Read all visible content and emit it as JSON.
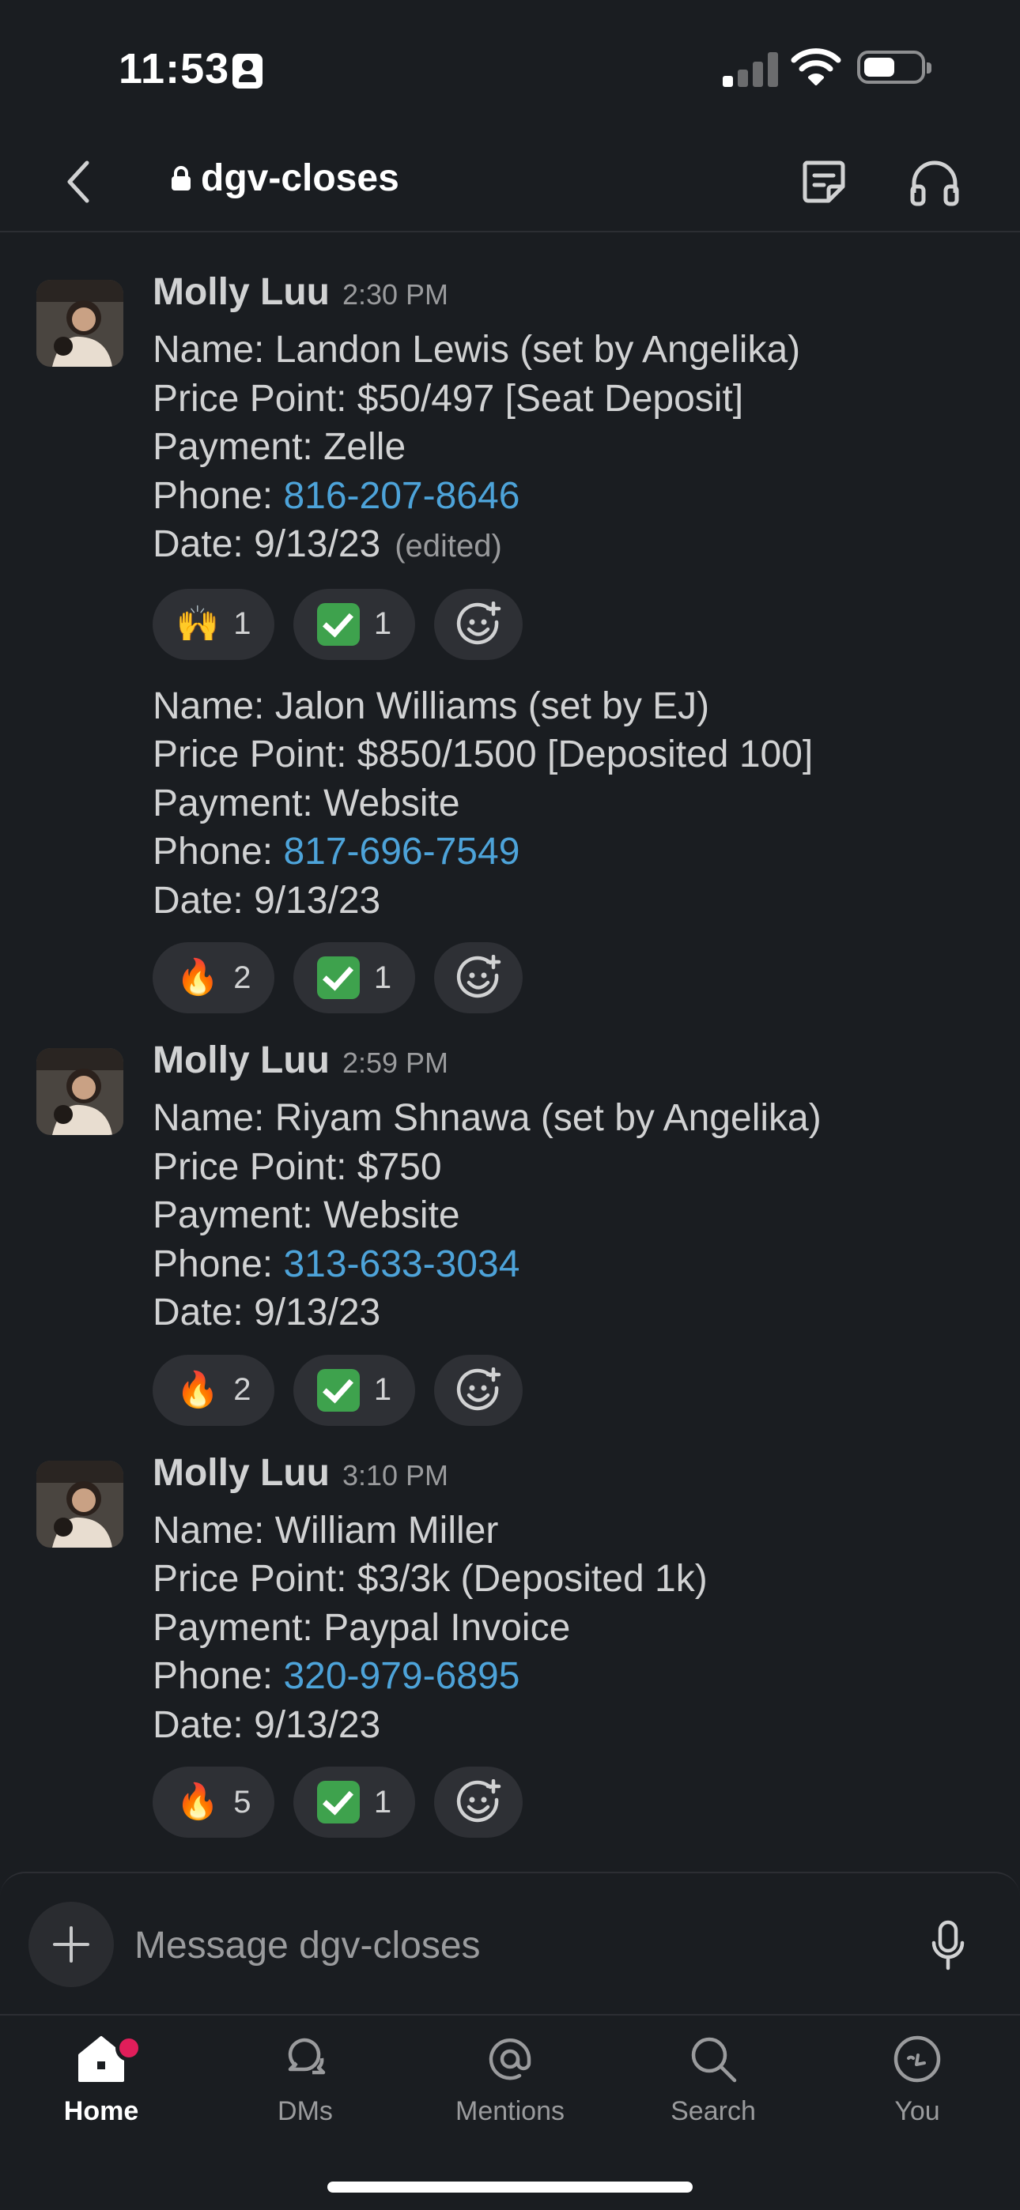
{
  "status_bar": {
    "time": "11:53"
  },
  "header": {
    "channel_name": "dgv-closes"
  },
  "messages": [
    {
      "author": "Molly Luu",
      "timestamp": "2:30 PM",
      "lines": [
        "Name: Landon Lewis (set by Angelika)",
        "Price Point: $50/497 [Seat Deposit]",
        "Payment: Zelle"
      ],
      "phone_label": "Phone: ",
      "phone": "816-207-8646",
      "date": "Date: 9/13/23",
      "edited": "(edited)",
      "reactions": [
        {
          "emoji": "🙌",
          "count": "1"
        },
        {
          "emoji": "✅",
          "count": "1"
        }
      ]
    },
    {
      "author": "",
      "timestamp": "",
      "lines": [
        "Name: Jalon Williams (set by EJ)",
        "Price Point: $850/1500 [Deposited 100]",
        "Payment: Website"
      ],
      "phone_label": "Phone: ",
      "phone": "817-696-7549",
      "date": "Date: 9/13/23",
      "reactions": [
        {
          "emoji": "🔥",
          "count": "2"
        },
        {
          "emoji": "✅",
          "count": "1"
        }
      ]
    },
    {
      "author": "Molly Luu",
      "timestamp": "2:59 PM",
      "lines": [
        "Name: Riyam Shnawa (set by Angelika)",
        "Price Point: $750",
        "Payment: Website"
      ],
      "phone_label": "Phone: ",
      "phone": "313-633-3034",
      "date": "Date: 9/13/23",
      "reactions": [
        {
          "emoji": "🔥",
          "count": "2"
        },
        {
          "emoji": "✅",
          "count": "1"
        }
      ]
    },
    {
      "author": "Molly Luu",
      "timestamp": "3:10 PM",
      "lines": [
        "Name: William Miller",
        "Price Point: $3/3k (Deposited 1k)",
        "Payment: Paypal Invoice"
      ],
      "phone_label": "Phone: ",
      "phone": "320-979-6895",
      "date": "Date: 9/13/23",
      "reactions": [
        {
          "emoji": "🔥",
          "count": "5"
        },
        {
          "emoji": "✅",
          "count": "1"
        }
      ]
    }
  ],
  "composer": {
    "placeholder": "Message dgv-closes"
  },
  "tabs": [
    {
      "label": "Home",
      "icon": "home-icon",
      "active": true
    },
    {
      "label": "DMs",
      "icon": "dms-icon"
    },
    {
      "label": "Mentions",
      "icon": "mentions-icon"
    },
    {
      "label": "Search",
      "icon": "search-icon"
    },
    {
      "label": "You",
      "icon": "you-icon"
    }
  ],
  "colors": {
    "background": "#1a1d21",
    "link": "#4da3d9",
    "badge": "#e01e5a",
    "check": "#3ea24d"
  }
}
